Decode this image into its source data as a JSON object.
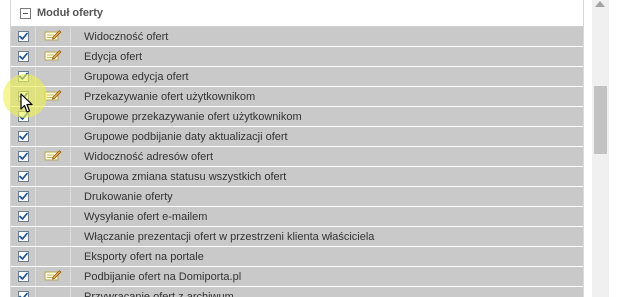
{
  "module": {
    "title": "Moduł oferty",
    "rows": [
      {
        "label": "Widoczność ofert",
        "checked": true,
        "has_edit_icon": true
      },
      {
        "label": "Edycja ofert",
        "checked": true,
        "has_edit_icon": true
      },
      {
        "label": "Grupowa edycja ofert",
        "checked": true,
        "has_edit_icon": false
      },
      {
        "label": "Przekazywanie ofert użytkownikom",
        "checked": true,
        "has_edit_icon": true
      },
      {
        "label": "Grupowe przekazywanie ofert użytkownikom",
        "checked": true,
        "has_edit_icon": false
      },
      {
        "label": "Grupowe podbijanie daty aktualizacji ofert",
        "checked": true,
        "has_edit_icon": false
      },
      {
        "label": "Widoczność adresów ofert",
        "checked": true,
        "has_edit_icon": true
      },
      {
        "label": "Grupowa zmiana statusu wszystkich ofert",
        "checked": true,
        "has_edit_icon": false
      },
      {
        "label": "Drukowanie oferty",
        "checked": true,
        "has_edit_icon": false
      },
      {
        "label": "Wysyłanie ofert e-mailem",
        "checked": true,
        "has_edit_icon": false
      },
      {
        "label": "Włączanie prezentacji ofert w przestrzeni klienta właściciela",
        "checked": true,
        "has_edit_icon": false
      },
      {
        "label": "Eksporty ofert na portale",
        "checked": true,
        "has_edit_icon": false
      },
      {
        "label": "Podbijanie ofert na Domiporta.pl",
        "checked": true,
        "has_edit_icon": true
      },
      {
        "label": "Przywracanie ofert z archiwum",
        "checked": true,
        "has_edit_icon": false
      }
    ]
  },
  "colors": {
    "row_background": "#c9c9c9",
    "checkbox_tick": "#1b4f9c",
    "cursor_highlight": "#ecf050"
  }
}
